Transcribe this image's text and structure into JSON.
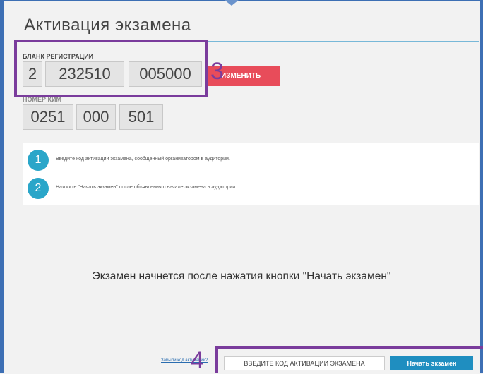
{
  "page": {
    "title": "Активация экзамена"
  },
  "registration": {
    "label": "БЛАНК РЕГИСТРАЦИИ",
    "fields": [
      "2",
      "232510",
      "005000"
    ],
    "change_label": "Изменить"
  },
  "kim": {
    "label": "НОМЕР КИМ",
    "fields": [
      "0251",
      "000",
      "501"
    ]
  },
  "steps": [
    {
      "num": "1",
      "text": "Введите код активации экзамена, сообщенный организатором в аудитории."
    },
    {
      "num": "2",
      "text": "Нажмите \"Начать экзамен\" после объявления о начале экзамена в аудитории."
    }
  ],
  "message": "Экзамен начнется после нажатия кнопки \"Начать экзамен\"",
  "footer": {
    "forgot_link": "Забыли код активации?",
    "code_placeholder": "ВВЕДИТЕ КОД АКТИВАЦИИ ЭКЗАМЕНА",
    "start_label": "Начать экзамен"
  },
  "annotations": {
    "registration_marker": "3",
    "footer_marker": "4",
    "color": "#7a3c9c"
  },
  "colors": {
    "accent": "#2aa6c9",
    "danger": "#e84c5a",
    "primary_button": "#1f8ec0"
  }
}
